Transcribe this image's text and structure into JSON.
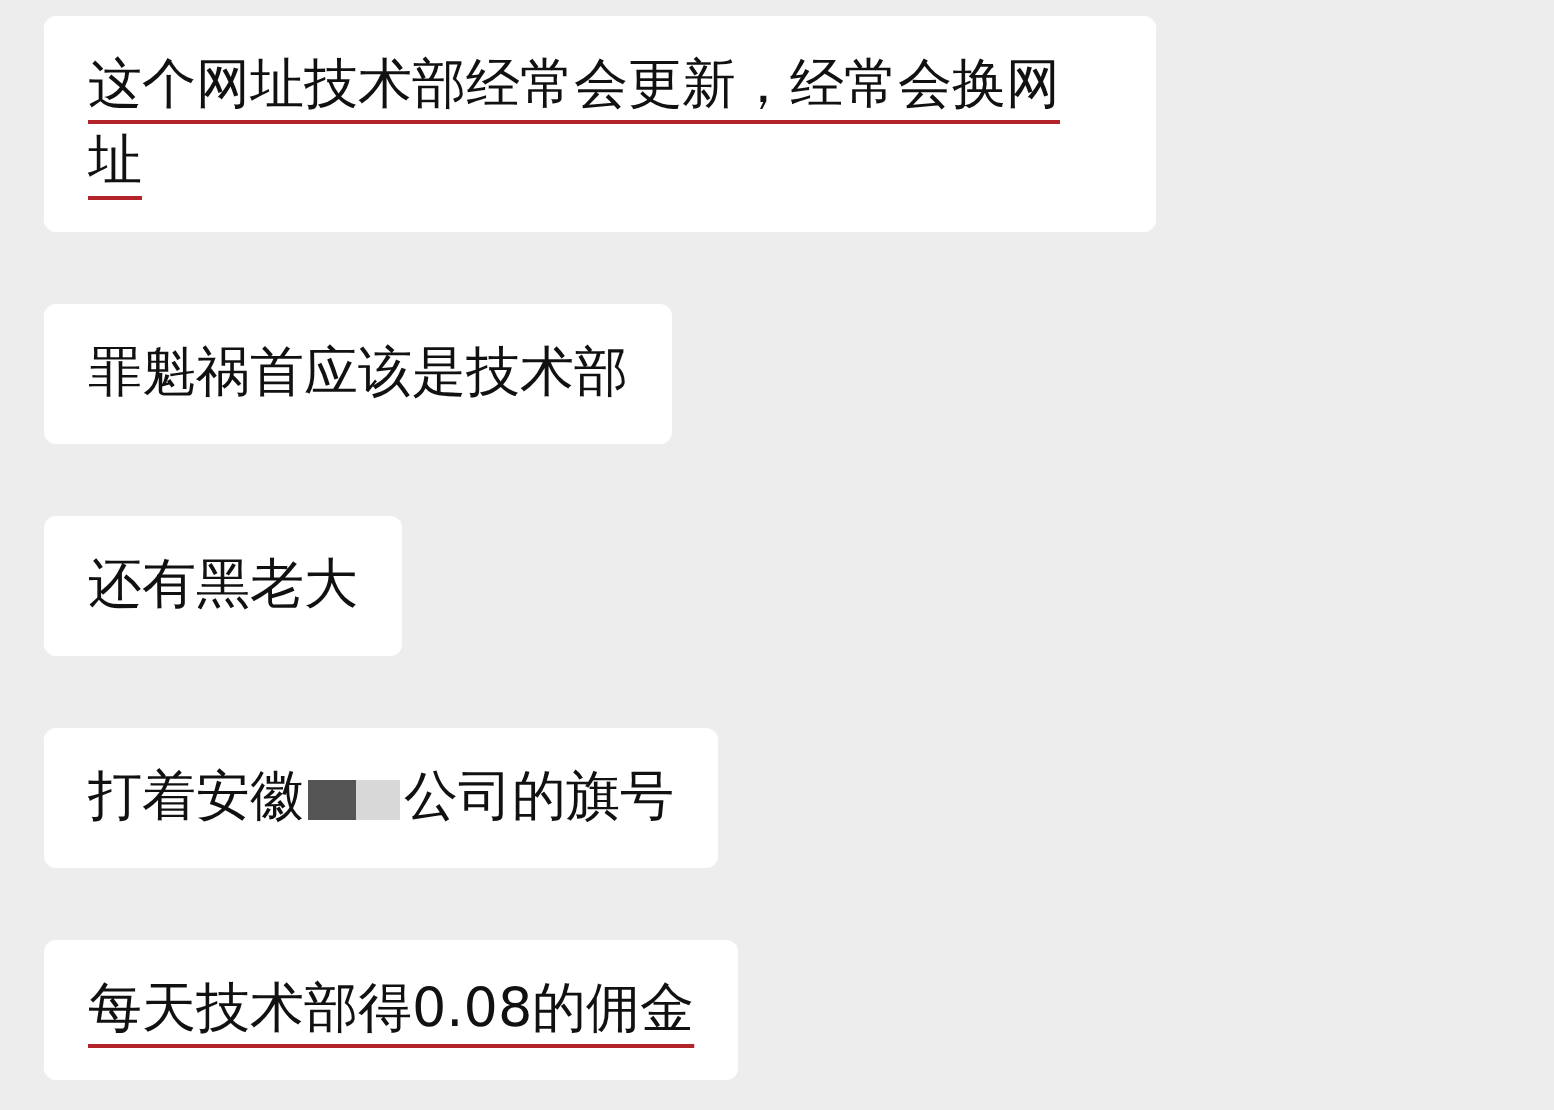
{
  "messages": [
    {
      "parts": [
        {
          "kind": "text",
          "text": "这个网址技术部经常会更新，经常会换网址"
        }
      ],
      "underlined": true
    },
    {
      "parts": [
        {
          "kind": "text",
          "text": "罪魁祸首应该是技术部"
        }
      ],
      "underlined": false
    },
    {
      "parts": [
        {
          "kind": "text",
          "text": "还有黑老大"
        }
      ],
      "underlined": false
    },
    {
      "parts": [
        {
          "kind": "text",
          "text": "打着安徽"
        },
        {
          "kind": "redacted"
        },
        {
          "kind": "text",
          "text": "公司的旗号"
        }
      ],
      "underlined": false
    },
    {
      "parts": [
        {
          "kind": "text",
          "text": "每天技术部得0.08的佣金"
        }
      ],
      "underlined": true
    }
  ]
}
